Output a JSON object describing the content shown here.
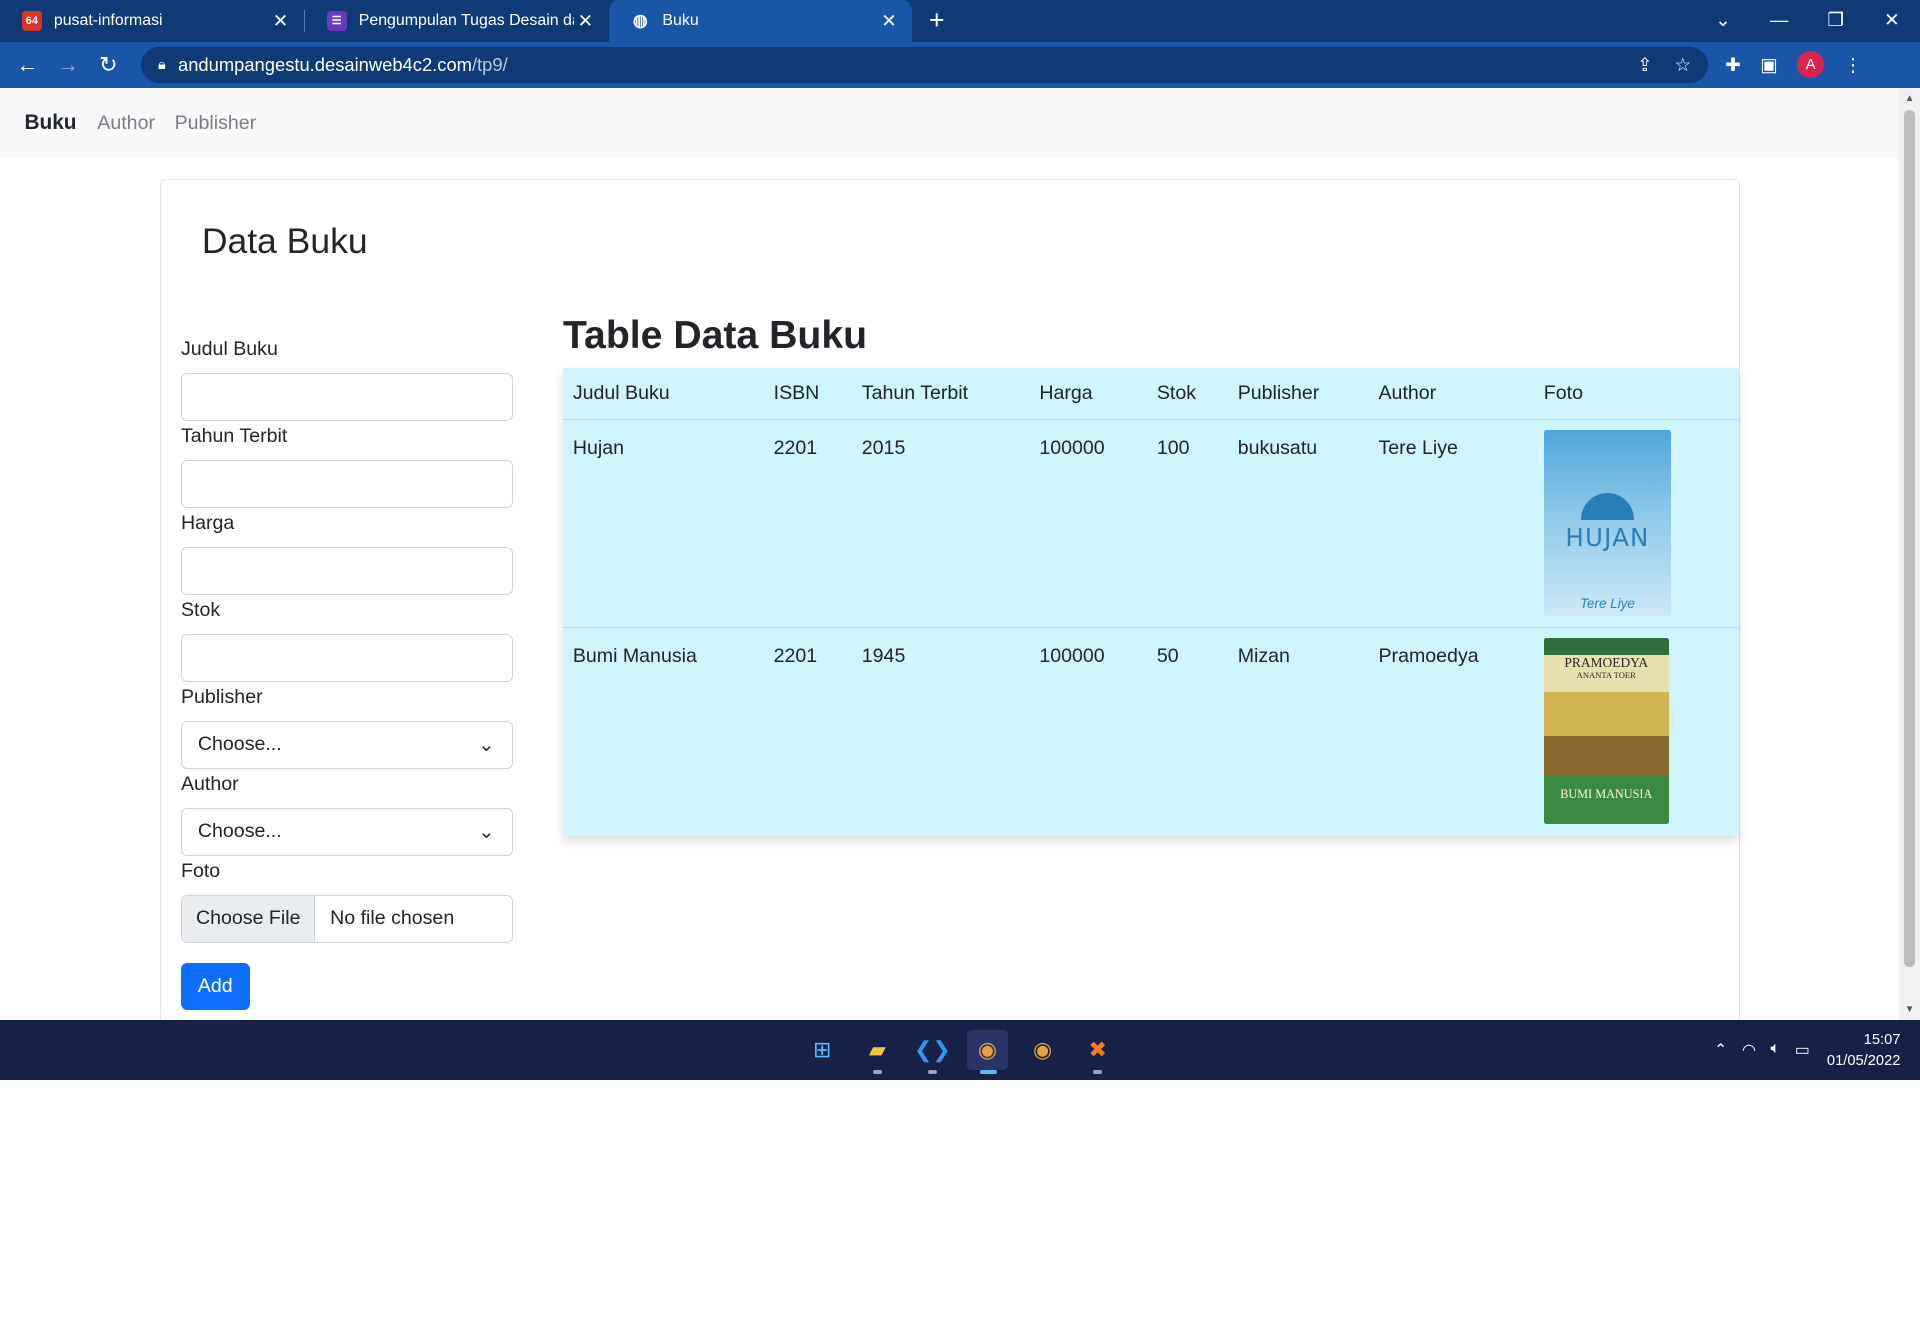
{
  "browser": {
    "tabs": [
      {
        "title": "pusat-informasi",
        "favicon": "64",
        "active": false
      },
      {
        "title": "Pengumpulan Tugas Desain dan I",
        "favicon": "",
        "active": false
      },
      {
        "title": "Buku",
        "favicon": "",
        "active": true
      }
    ],
    "url_host": "andumpangestu.desainweb4c2.com",
    "url_path": "/tp9/",
    "profile_initial": "A"
  },
  "navbar": {
    "brand": "Buku",
    "links": [
      "Author",
      "Publisher"
    ]
  },
  "card": {
    "title": "Data Buku"
  },
  "form": {
    "judul_label": "Judul Buku",
    "tahun_label": "Tahun Terbit",
    "harga_label": "Harga",
    "stok_label": "Stok",
    "publisher_label": "Publisher",
    "publisher_value": "Choose...",
    "author_label": "Author",
    "author_value": "Choose...",
    "foto_label": "Foto",
    "file_button": "Choose File",
    "file_status": "No file chosen",
    "add_button": "Add"
  },
  "table": {
    "title": "Table Data Buku",
    "headers": [
      "Judul Buku",
      "ISBN",
      "Tahun Terbit",
      "Harga",
      "Stok",
      "Publisher",
      "Author",
      "Foto"
    ],
    "rows": [
      {
        "judul": "Hujan",
        "isbn": "2201",
        "tahun": "2015",
        "harga": "100000",
        "stok": "100",
        "publisher": "bukusatu",
        "author": "Tere Liye",
        "cover_title": "HUJAN",
        "cover_author": "Tere Liye"
      },
      {
        "judul": "Bumi Manusia",
        "isbn": "2201",
        "tahun": "1945",
        "harga": "100000",
        "stok": "50",
        "publisher": "Mizan",
        "author": "Pramoedya",
        "cover_title": "BUMI MANUSIA",
        "cover_author": "PRAMOEDYA",
        "cover_author_sub": "ANANTA TOER"
      }
    ]
  },
  "taskbar": {
    "time": "15:07",
    "date": "01/05/2022"
  }
}
